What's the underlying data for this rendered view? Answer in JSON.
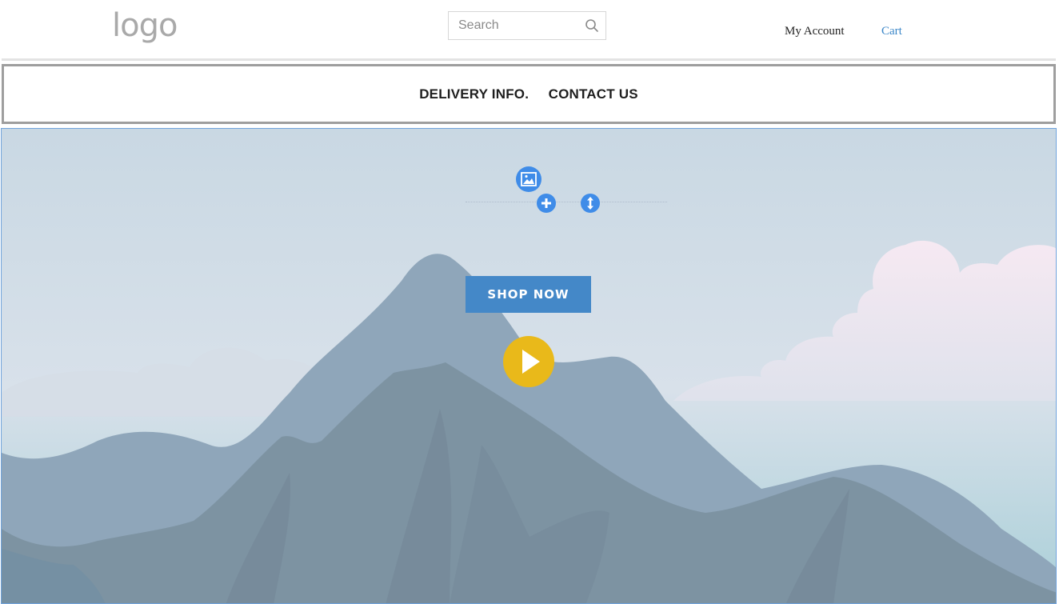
{
  "header": {
    "logo_text": "logo",
    "search": {
      "placeholder": "Search",
      "icon": "search-icon"
    },
    "account_link": "My Account",
    "cart_link": "Cart"
  },
  "nav": {
    "links": [
      "DELIVERY INFO.",
      "CONTACT US"
    ]
  },
  "hero": {
    "editor_tools": [
      "image-icon",
      "plus-icon",
      "resize-vertical-icon"
    ],
    "cta_label": "SHOP NOW",
    "play_icon": "play-icon"
  },
  "colors": {
    "accent_blue": "#4488c8",
    "link_blue": "#3a86c8",
    "play_yellow": "#e9b91a",
    "tool_blue": "#3f8ce8",
    "sky_top": "#c9d8e3",
    "mountain_back": "#8fa6ba",
    "mountain_front": "#7d93a2"
  }
}
